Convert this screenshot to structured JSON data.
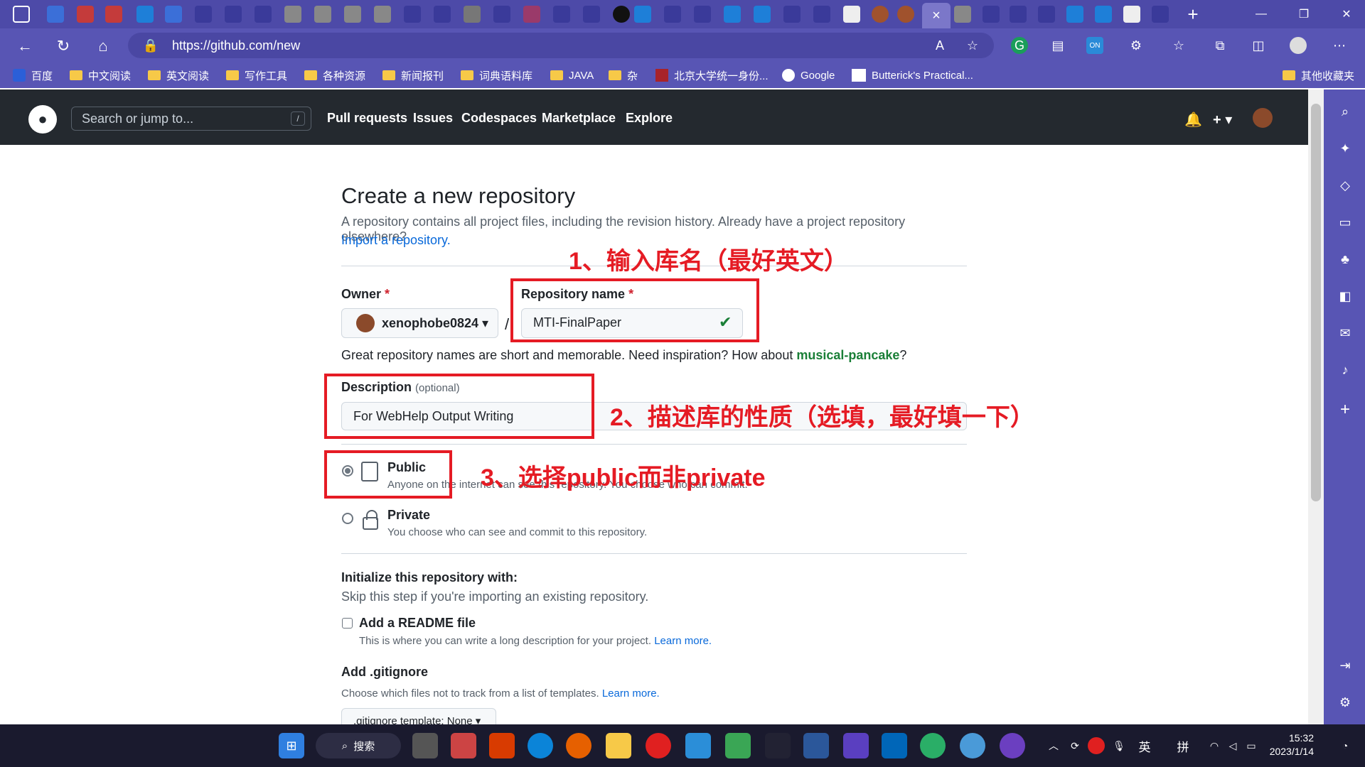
{
  "browser": {
    "url": "https://github.com/new",
    "tab_close": "×",
    "new_tab": "+",
    "window": {
      "minimize": "—",
      "restore": "❐",
      "close": "✕"
    },
    "extension_badge": "ON"
  },
  "bookmarks": [
    {
      "label": "百度",
      "icon": "paw-icon"
    },
    {
      "label": "中文阅读",
      "icon": "folder-icon"
    },
    {
      "label": "英文阅读",
      "icon": "folder-icon"
    },
    {
      "label": "写作工具",
      "icon": "folder-icon"
    },
    {
      "label": "各种资源",
      "icon": "folder-icon"
    },
    {
      "label": "新闻报刊",
      "icon": "folder-icon"
    },
    {
      "label": "词典语料库",
      "icon": "folder-icon"
    },
    {
      "label": "JAVA",
      "icon": "folder-icon"
    },
    {
      "label": "杂",
      "icon": "folder-icon"
    },
    {
      "label": "北京大学统一身份...",
      "icon": "pku-icon"
    },
    {
      "label": "Google",
      "icon": "google-icon"
    },
    {
      "label": "Butterick's Practical...",
      "icon": "pt-icon"
    },
    {
      "label": "其他收藏夹",
      "icon": "folder-icon"
    }
  ],
  "github": {
    "search_placeholder": "Search or jump to...",
    "search_key": "/",
    "nav": [
      "Pull requests",
      "Issues",
      "Codespaces",
      "Marketplace",
      "Explore"
    ],
    "plus": "+ ▾"
  },
  "form": {
    "title": "Create a new repository",
    "lead": "A repository contains all project files, including the revision history. Already have a project repository elsewhere?",
    "import_link": "Import a repository.",
    "owner_label": "Owner",
    "required": "*",
    "owner_value": "xenophobe0824 ▾",
    "separator": "/",
    "repo_label": "Repository name",
    "repo_value": "MTI-FinalPaper",
    "repo_valid": "✔",
    "hint_prefix": "Great repository names are short and memorable. Need inspiration? How about",
    "hint_suggestion": "musical-pancake",
    "hint_suffix": "?",
    "desc_label": "Description",
    "desc_optional": "(optional)",
    "desc_value": "For WebHelp Output Writing",
    "public_title": "Public",
    "public_sub": "Anyone on the internet can see this repository. You choose who can commit.",
    "private_title": "Private",
    "private_sub": "You choose who can see and commit to this repository.",
    "init_title": "Initialize this repository with:",
    "init_sub": "Skip this step if you're importing an existing repository.",
    "readme_label": "Add a README file",
    "readme_sub": "This is where you can write a long description for your project.",
    "learn_more": "Learn more.",
    "gitignore_label": "Add .gitignore",
    "gitignore_sub": "Choose which files not to track from a list of templates.",
    "gitignore_select": ".gitignore template: None ▾"
  },
  "annotations": {
    "step1": "1、输入库名（最好英文）",
    "step2": "2、描述库的性质（选填，最好填一下）",
    "step3": "3、选择public而非private",
    "color": "#e51b24"
  },
  "taskbar": {
    "search": "搜索",
    "ime1": "英",
    "ime2": "拼",
    "time": "15:32",
    "date": "2023/1/14"
  },
  "colors": {
    "browser_chrome": "#5855b4",
    "github_header": "#24292f",
    "link": "#0969da",
    "success": "#1a7f37"
  }
}
